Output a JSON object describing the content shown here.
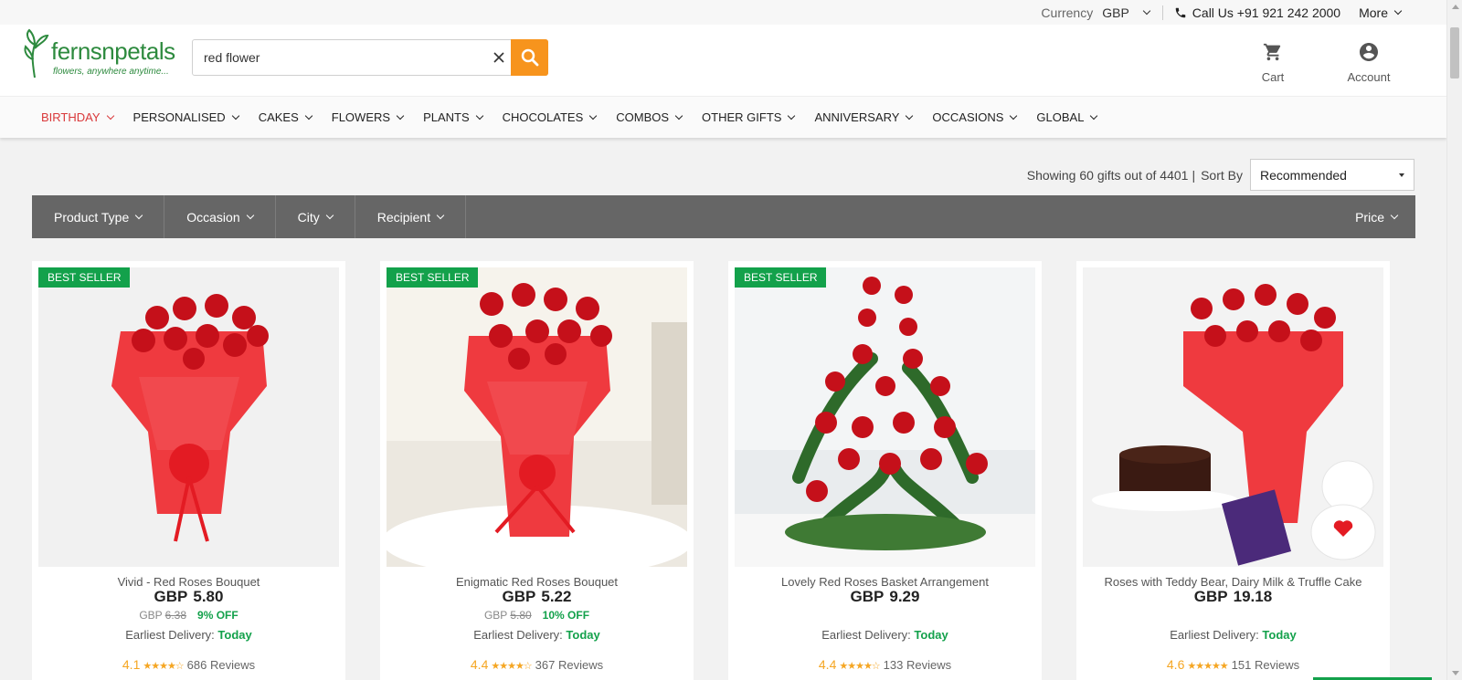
{
  "topbar": {
    "currency_label": "Currency",
    "currency_value": "GBP",
    "call_text": "Call Us +91 921 242 2000",
    "more_label": "More"
  },
  "header": {
    "logo_text": "fernsnpetals",
    "logo_tagline": "flowers, anywhere anytime...",
    "search_value": "red flower",
    "cart_label": "Cart",
    "account_label": "Account"
  },
  "nav": [
    {
      "label": "BIRTHDAY"
    },
    {
      "label": "PERSONALISED"
    },
    {
      "label": "CAKES"
    },
    {
      "label": "FLOWERS"
    },
    {
      "label": "PLANTS"
    },
    {
      "label": "CHOCOLATES"
    },
    {
      "label": "COMBOS"
    },
    {
      "label": "OTHER GIFTS"
    },
    {
      "label": "ANNIVERSARY"
    },
    {
      "label": "OCCASIONS"
    },
    {
      "label": "GLOBAL"
    }
  ],
  "results": {
    "showing_text": "Showing 60 gifts out of 4401",
    "sort_label": "Sort By",
    "sort_value": "Recommended"
  },
  "filters": [
    {
      "label": "Product Type"
    },
    {
      "label": "Occasion"
    },
    {
      "label": "City"
    },
    {
      "label": "Recipient"
    }
  ],
  "price_filter": "Price",
  "products": [
    {
      "badge": "BEST SELLER",
      "name": "Vivid - Red Roses Bouquet",
      "currency": "GBP",
      "price": "5.80",
      "mrp_currency": "GBP",
      "mrp": "6.38",
      "discount": "9% OFF",
      "delivery_label": "Earliest Delivery:",
      "delivery_value": "Today",
      "rating": "4.1",
      "stars": "★★★★☆",
      "reviews": "686 Reviews"
    },
    {
      "badge": "BEST SELLER",
      "name": "Enigmatic Red Roses Bouquet",
      "currency": "GBP",
      "price": "5.22",
      "mrp_currency": "GBP",
      "mrp": "5.80",
      "discount": "10% OFF",
      "delivery_label": "Earliest Delivery:",
      "delivery_value": "Today",
      "rating": "4.4",
      "stars": "★★★★☆",
      "reviews": "367 Reviews"
    },
    {
      "badge": "BEST SELLER",
      "name": "Lovely Red Roses Basket Arrangement",
      "currency": "GBP",
      "price": "9.29",
      "delivery_label": "Earliest Delivery:",
      "delivery_value": "Today",
      "rating": "4.4",
      "stars": "★★★★☆",
      "reviews": "133 Reviews"
    },
    {
      "name": "Roses with Teddy Bear, Dairy Milk & Truffle Cake",
      "currency": "GBP",
      "price": "19.18",
      "delivery_label": "Earliest Delivery:",
      "delivery_value": "Today",
      "rating": "4.6",
      "stars": "★★★★★",
      "reviews": "151 Reviews"
    }
  ],
  "colors": {
    "brand_green": "#2d8a3e",
    "search_button": "#f7941d",
    "badge_green": "#13a14b",
    "nav_active": "#d9383a",
    "filter_bar": "#666666",
    "star": "#f5a623"
  }
}
